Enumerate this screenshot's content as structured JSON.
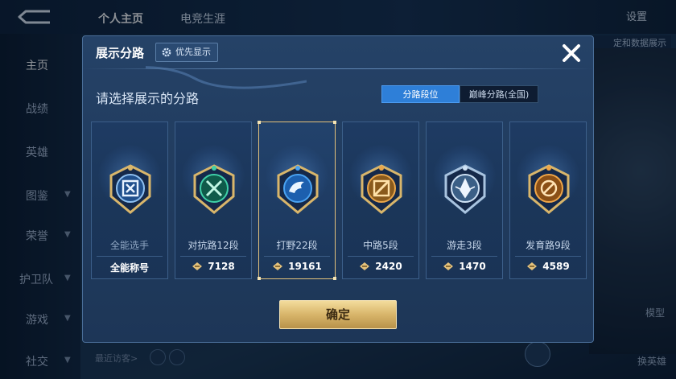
{
  "background": {
    "tabs": [
      "个人主页",
      "电竞生涯"
    ],
    "settings_label": "设置",
    "chip_text": "定和数据展示",
    "sidebar": [
      {
        "label": "主页",
        "active": true,
        "chevron": false
      },
      {
        "label": "战绩",
        "active": false,
        "chevron": false
      },
      {
        "label": "英雄",
        "active": false,
        "chevron": false
      },
      {
        "label": "图鉴",
        "active": false,
        "chevron": true
      },
      {
        "label": "荣誉",
        "active": false,
        "chevron": true
      },
      {
        "label": "护卫队",
        "active": false,
        "chevron": true
      },
      {
        "label": "游戏",
        "active": false,
        "chevron": true
      },
      {
        "label": "社交",
        "active": false,
        "chevron": true
      }
    ],
    "visitor_label": "最近访客>",
    "model_label": "模型",
    "swap_label": "换英雄"
  },
  "dialog": {
    "title": "展示分路",
    "priority_label": "优先显示",
    "subtitle": "请选择展示的分路",
    "segments": [
      {
        "label": "分路段位",
        "active": true
      },
      {
        "label": "巅峰分路(全国)",
        "active": false
      }
    ],
    "cards": [
      {
        "name": "全能选手",
        "stat": "全能称号",
        "has_icon": false,
        "selected": false,
        "emblem": "all-round-emblem-icon",
        "accent": "#7fb7ee"
      },
      {
        "name": "对抗路12段",
        "stat": "7128",
        "has_icon": true,
        "selected": false,
        "emblem": "clash-lane-emblem-icon",
        "accent": "#3fd0a8"
      },
      {
        "name": "打野22段",
        "stat": "19161",
        "has_icon": true,
        "selected": true,
        "emblem": "jungle-emblem-icon",
        "accent": "#4aa3f2"
      },
      {
        "name": "中路5段",
        "stat": "2420",
        "has_icon": true,
        "selected": false,
        "emblem": "mid-lane-emblem-icon",
        "accent": "#e9a64a"
      },
      {
        "name": "游走3段",
        "stat": "1470",
        "has_icon": true,
        "selected": false,
        "emblem": "roam-emblem-icon",
        "accent": "#a9c4e0"
      },
      {
        "name": "发育路9段",
        "stat": "4589",
        "has_icon": true,
        "selected": false,
        "emblem": "farm-lane-emblem-icon",
        "accent": "#f0a648"
      }
    ],
    "confirm_label": "确定"
  },
  "colors": {
    "gold": "#e4c27c",
    "accent_blue": "#2e7fd8",
    "panel": "#213c5f"
  }
}
